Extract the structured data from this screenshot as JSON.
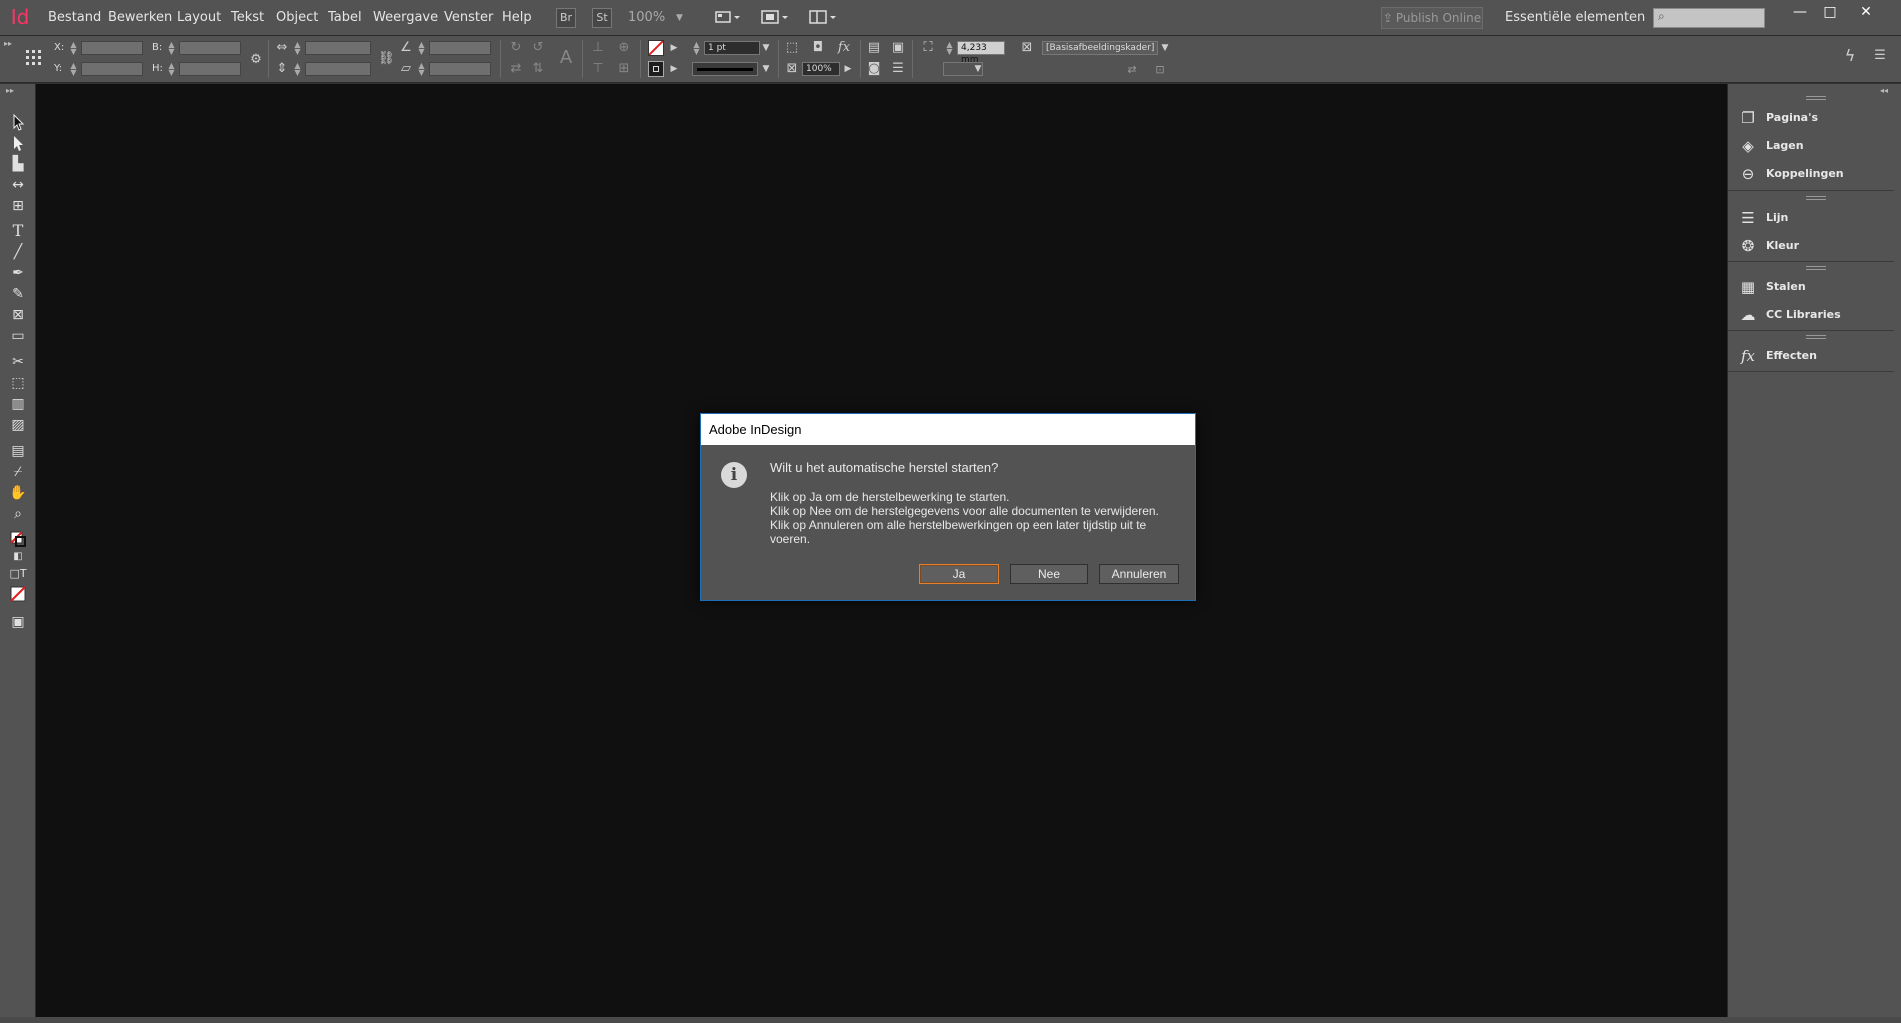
{
  "app": {
    "logo": "Id"
  },
  "menu": {
    "items": [
      "Bestand",
      "Bewerken",
      "Layout",
      "Tekst",
      "Object",
      "Tabel",
      "Weergave",
      "Venster",
      "Help"
    ],
    "bridge_label": "Br",
    "stock_label": "St",
    "zoom": "100%",
    "publish_label": "Publish Online",
    "workspace_label": "Essentiële elementen",
    "search_icon": "⌕",
    "window_controls": {
      "minimize": "—",
      "maximize": "□",
      "close": "✕"
    }
  },
  "control": {
    "x_label": "X:",
    "y_label": "Y:",
    "w_label": "B:",
    "h_label": "H:",
    "stroke_weight": "1 pt",
    "opacity": "100%",
    "offset_value": "4,233 mm",
    "object_style": "[Basisafbeeldingskader]"
  },
  "dock": {
    "groups": [
      [
        {
          "label": "Pagina's",
          "icon": "pages-icon"
        },
        {
          "label": "Lagen",
          "icon": "layers-icon"
        },
        {
          "label": "Koppelingen",
          "icon": "links-icon"
        }
      ],
      [
        {
          "label": "Lijn",
          "icon": "stroke-icon"
        },
        {
          "label": "Kleur",
          "icon": "color-icon"
        }
      ],
      [
        {
          "label": "Stalen",
          "icon": "swatches-icon"
        },
        {
          "label": "CC Libraries",
          "icon": "cc-libraries-icon"
        }
      ],
      [
        {
          "label": "Effecten",
          "icon": "effects-icon"
        }
      ]
    ]
  },
  "dialog": {
    "title": "Adobe InDesign",
    "question": "Wilt u het automatische herstel starten?",
    "lines": [
      "Klik op Ja om de herstelbewerking te starten.",
      "Klik op Nee om de herstelgegevens voor alle documenten te verwijderen.",
      "Klik op Annuleren om alle herstelbewerkingen op een later tijdstip uit te",
      "voeren."
    ],
    "buttons": {
      "yes": "Ja",
      "no": "Nee",
      "cancel": "Annuleren"
    }
  },
  "colors": {
    "accent": "#ff3366",
    "panel": "#535353",
    "pasteboard": "#101010",
    "dialog_border": "#1f6fb8",
    "default_button_border": "#e08030"
  }
}
